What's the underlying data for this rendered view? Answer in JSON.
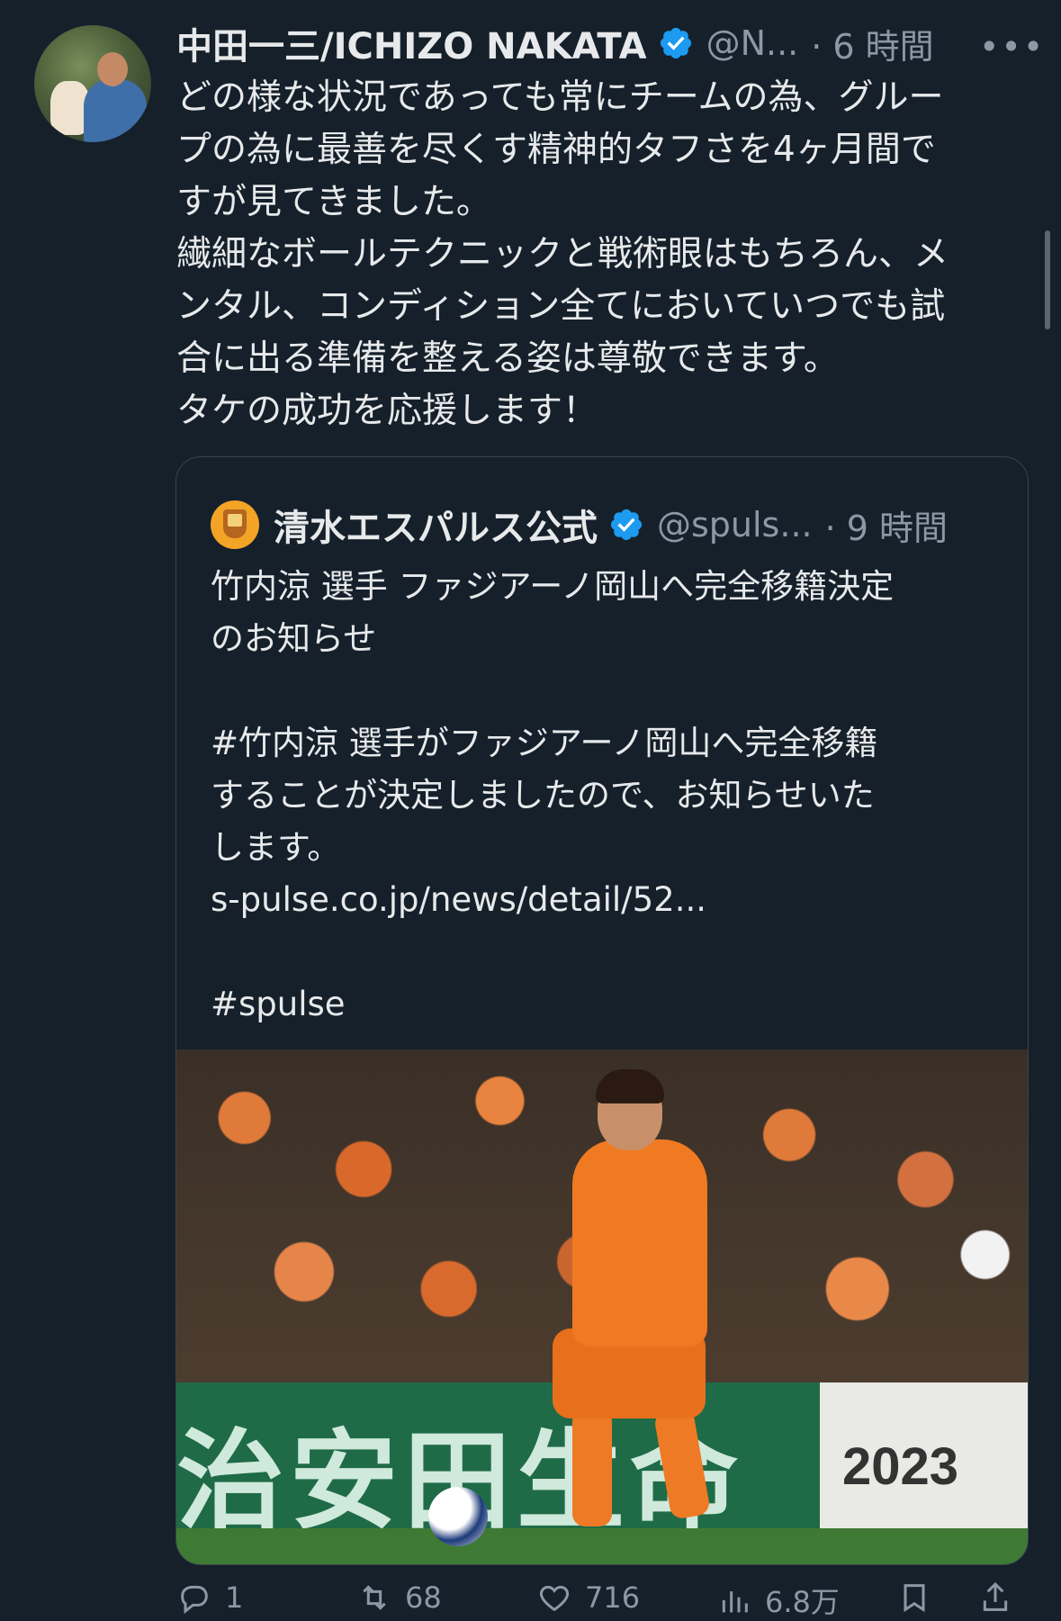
{
  "tweet": {
    "author_name": "中田一三/ICHIZO NAKATA",
    "author_handle": "@N...",
    "time": "· 6 時間",
    "more_label": "•••",
    "lines": [
      "どの様な状況であっても常にチームの為、グルー",
      "プの為に最善を尽くす精神的タフさを4ヶ月間で",
      "すが見てきました。",
      "繊細なボールテクニックと戦術眼はもちろん、メ",
      "ンタル、コンディション全てにおいていつでも試",
      "合に出る準備を整える姿は尊敬できます。",
      "タケの成功を応援します！"
    ]
  },
  "quoted": {
    "author_name": "清水エスパルス公式",
    "author_handle": "@spuls...",
    "time": "· 9 時間",
    "lines": [
      "竹内涼 選手 ファジアーノ岡山へ完全移籍決定",
      "のお知らせ",
      "",
      "#竹内涼 選手がファジアーノ岡山へ完全移籍",
      "することが決定しましたので、お知らせいた",
      "します。",
      "s-pulse.co.jp/news/detail/52...",
      "",
      "#spulse"
    ],
    "photo": {
      "board_text": "治安田生命",
      "board_year": "2023"
    }
  },
  "actions": {
    "reply_count": "1",
    "retweet_count": "68",
    "like_count": "716",
    "views_count": "6.8万"
  },
  "colors": {
    "background": "#15202b",
    "text": "#e7e9ea",
    "secondary": "#8b98a5",
    "verified": "#1d9bf0"
  }
}
